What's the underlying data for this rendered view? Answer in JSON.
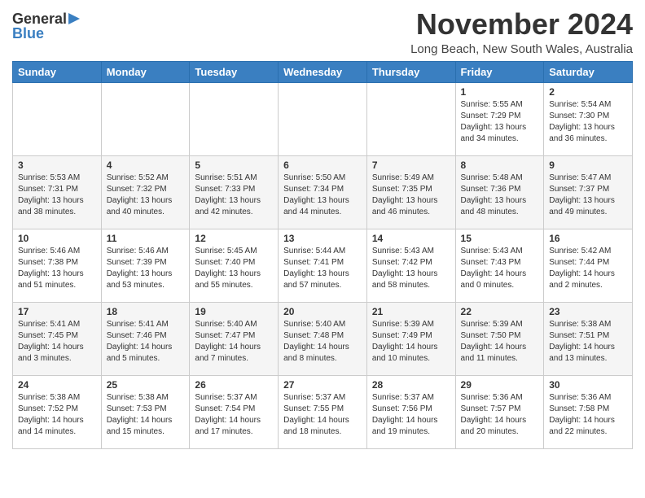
{
  "header": {
    "logo_general": "General",
    "logo_blue": "Blue",
    "month_title": "November 2024",
    "location": "Long Beach, New South Wales, Australia"
  },
  "days_of_week": [
    "Sunday",
    "Monday",
    "Tuesday",
    "Wednesday",
    "Thursday",
    "Friday",
    "Saturday"
  ],
  "weeks": [
    [
      {
        "day": "",
        "sunrise": "",
        "sunset": "",
        "daylight": ""
      },
      {
        "day": "",
        "sunrise": "",
        "sunset": "",
        "daylight": ""
      },
      {
        "day": "",
        "sunrise": "",
        "sunset": "",
        "daylight": ""
      },
      {
        "day": "",
        "sunrise": "",
        "sunset": "",
        "daylight": ""
      },
      {
        "day": "",
        "sunrise": "",
        "sunset": "",
        "daylight": ""
      },
      {
        "day": "1",
        "sunrise": "5:55 AM",
        "sunset": "7:29 PM",
        "daylight": "13 hours and 34 minutes."
      },
      {
        "day": "2",
        "sunrise": "5:54 AM",
        "sunset": "7:30 PM",
        "daylight": "13 hours and 36 minutes."
      }
    ],
    [
      {
        "day": "3",
        "sunrise": "5:53 AM",
        "sunset": "7:31 PM",
        "daylight": "13 hours and 38 minutes."
      },
      {
        "day": "4",
        "sunrise": "5:52 AM",
        "sunset": "7:32 PM",
        "daylight": "13 hours and 40 minutes."
      },
      {
        "day": "5",
        "sunrise": "5:51 AM",
        "sunset": "7:33 PM",
        "daylight": "13 hours and 42 minutes."
      },
      {
        "day": "6",
        "sunrise": "5:50 AM",
        "sunset": "7:34 PM",
        "daylight": "13 hours and 44 minutes."
      },
      {
        "day": "7",
        "sunrise": "5:49 AM",
        "sunset": "7:35 PM",
        "daylight": "13 hours and 46 minutes."
      },
      {
        "day": "8",
        "sunrise": "5:48 AM",
        "sunset": "7:36 PM",
        "daylight": "13 hours and 48 minutes."
      },
      {
        "day": "9",
        "sunrise": "5:47 AM",
        "sunset": "7:37 PM",
        "daylight": "13 hours and 49 minutes."
      }
    ],
    [
      {
        "day": "10",
        "sunrise": "5:46 AM",
        "sunset": "7:38 PM",
        "daylight": "13 hours and 51 minutes."
      },
      {
        "day": "11",
        "sunrise": "5:46 AM",
        "sunset": "7:39 PM",
        "daylight": "13 hours and 53 minutes."
      },
      {
        "day": "12",
        "sunrise": "5:45 AM",
        "sunset": "7:40 PM",
        "daylight": "13 hours and 55 minutes."
      },
      {
        "day": "13",
        "sunrise": "5:44 AM",
        "sunset": "7:41 PM",
        "daylight": "13 hours and 57 minutes."
      },
      {
        "day": "14",
        "sunrise": "5:43 AM",
        "sunset": "7:42 PM",
        "daylight": "13 hours and 58 minutes."
      },
      {
        "day": "15",
        "sunrise": "5:43 AM",
        "sunset": "7:43 PM",
        "daylight": "14 hours and 0 minutes."
      },
      {
        "day": "16",
        "sunrise": "5:42 AM",
        "sunset": "7:44 PM",
        "daylight": "14 hours and 2 minutes."
      }
    ],
    [
      {
        "day": "17",
        "sunrise": "5:41 AM",
        "sunset": "7:45 PM",
        "daylight": "14 hours and 3 minutes."
      },
      {
        "day": "18",
        "sunrise": "5:41 AM",
        "sunset": "7:46 PM",
        "daylight": "14 hours and 5 minutes."
      },
      {
        "day": "19",
        "sunrise": "5:40 AM",
        "sunset": "7:47 PM",
        "daylight": "14 hours and 7 minutes."
      },
      {
        "day": "20",
        "sunrise": "5:40 AM",
        "sunset": "7:48 PM",
        "daylight": "14 hours and 8 minutes."
      },
      {
        "day": "21",
        "sunrise": "5:39 AM",
        "sunset": "7:49 PM",
        "daylight": "14 hours and 10 minutes."
      },
      {
        "day": "22",
        "sunrise": "5:39 AM",
        "sunset": "7:50 PM",
        "daylight": "14 hours and 11 minutes."
      },
      {
        "day": "23",
        "sunrise": "5:38 AM",
        "sunset": "7:51 PM",
        "daylight": "14 hours and 13 minutes."
      }
    ],
    [
      {
        "day": "24",
        "sunrise": "5:38 AM",
        "sunset": "7:52 PM",
        "daylight": "14 hours and 14 minutes."
      },
      {
        "day": "25",
        "sunrise": "5:38 AM",
        "sunset": "7:53 PM",
        "daylight": "14 hours and 15 minutes."
      },
      {
        "day": "26",
        "sunrise": "5:37 AM",
        "sunset": "7:54 PM",
        "daylight": "14 hours and 17 minutes."
      },
      {
        "day": "27",
        "sunrise": "5:37 AM",
        "sunset": "7:55 PM",
        "daylight": "14 hours and 18 minutes."
      },
      {
        "day": "28",
        "sunrise": "5:37 AM",
        "sunset": "7:56 PM",
        "daylight": "14 hours and 19 minutes."
      },
      {
        "day": "29",
        "sunrise": "5:36 AM",
        "sunset": "7:57 PM",
        "daylight": "14 hours and 20 minutes."
      },
      {
        "day": "30",
        "sunrise": "5:36 AM",
        "sunset": "7:58 PM",
        "daylight": "14 hours and 22 minutes."
      }
    ]
  ]
}
